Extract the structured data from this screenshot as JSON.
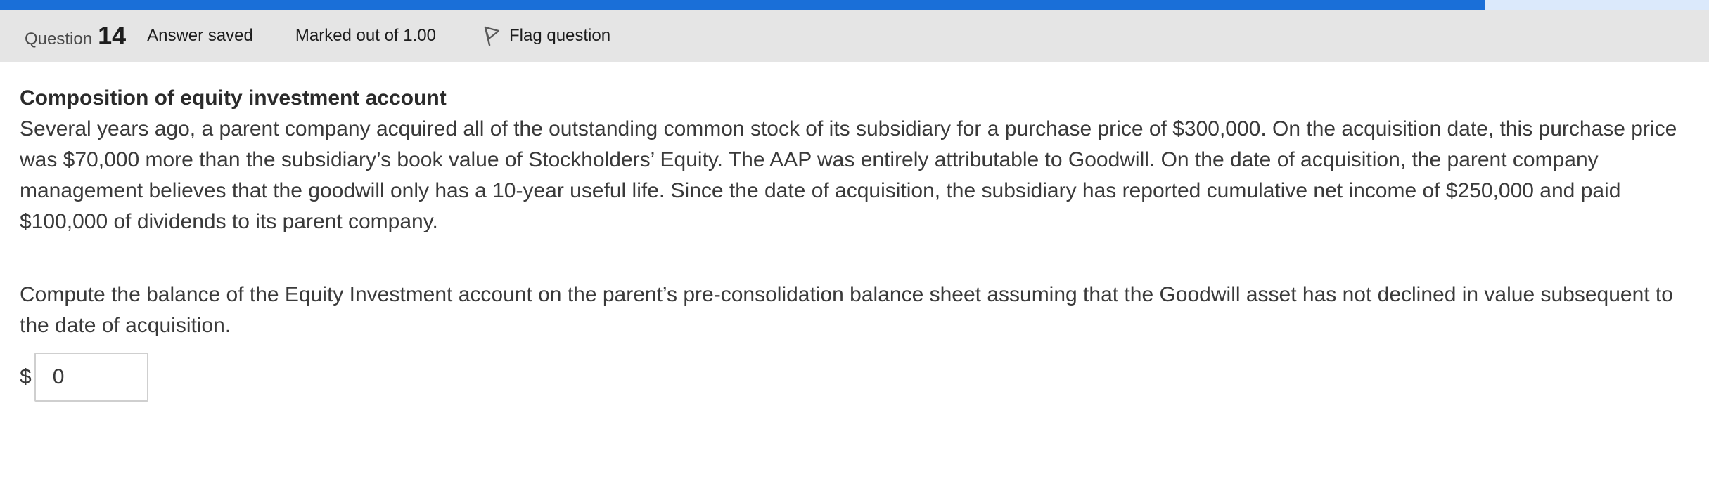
{
  "progress": {
    "fraction": 0.869
  },
  "header": {
    "question_label": "Question",
    "question_number": "14",
    "state": "Answer saved",
    "grade": "Marked out of 1.00",
    "flag_label": "Flag question",
    "flag_icon": "flag-icon"
  },
  "question": {
    "title": "Composition of equity investment account",
    "body": "Several years ago, a parent company acquired all of the outstanding common stock of its subsidiary for a purchase price of $300,000. On the acquisition date, this purchase price was $70,000 more than the subsidiary’s book value of Stockholders’ Equity. The AAP was entirely attributable to Goodwill. On the date of acquisition, the parent company management believes that the goodwill only has a 10-year useful life. Since the date of acquisition, the subsidiary has reported cumulative net income of $250,000 and paid $100,000 of dividends to its parent company.",
    "prompt": "Compute the balance of the Equity Investment account on the parent’s pre-consolidation balance sheet assuming that the Goodwill asset has not declined in value subsequent to the date of acquisition.",
    "currency_symbol": "$",
    "answer_value": "0"
  },
  "colors": {
    "progress_fill": "#1a6fd8",
    "progress_track": "#dbe9fb",
    "info_bar_bg": "#e5e5e5"
  }
}
